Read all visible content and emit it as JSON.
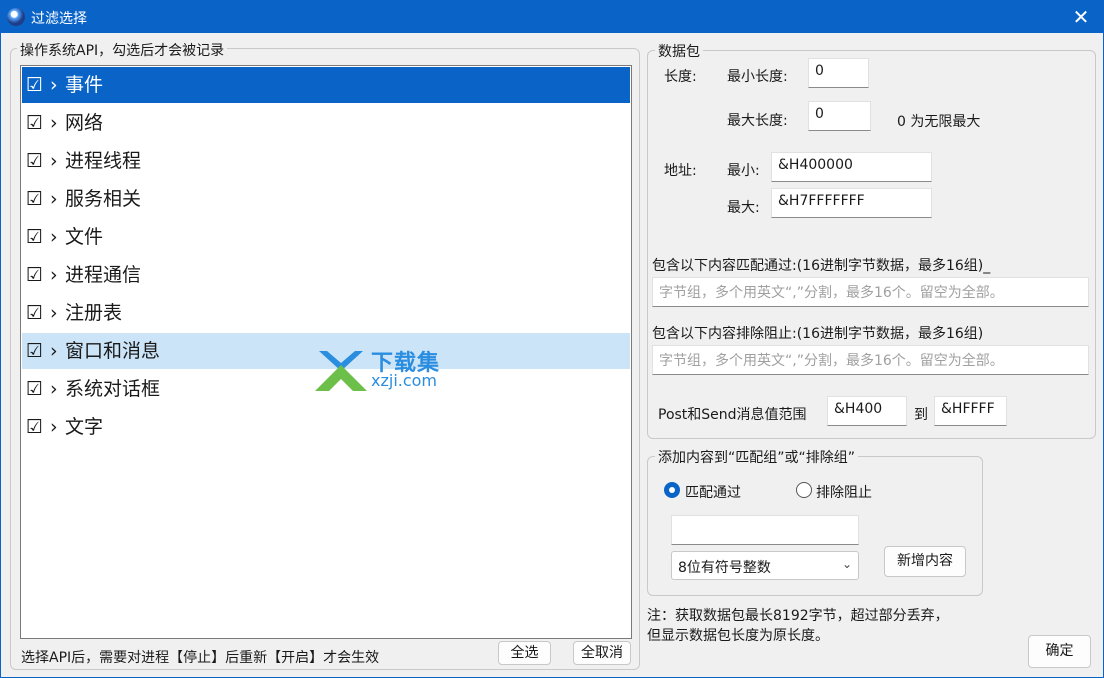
{
  "window": {
    "title": "过滤选择",
    "close_glyph": "✕"
  },
  "api_group": {
    "legend": "操作系统API，勾选后才会被记录",
    "items": [
      {
        "label": "事件"
      },
      {
        "label": "网络"
      },
      {
        "label": "进程线程"
      },
      {
        "label": "服务相关"
      },
      {
        "label": "文件"
      },
      {
        "label": "进程通信"
      },
      {
        "label": "注册表"
      },
      {
        "label": "窗口和消息"
      },
      {
        "label": "系统对话框"
      },
      {
        "label": "文字"
      }
    ],
    "check_glyph": "☑",
    "arrow_glyph": "›",
    "footer_note": "选择API后，需要对进程【停止】后重新【开启】才会生效",
    "select_all_label": "全选",
    "deselect_all_label": "全取消"
  },
  "packet_group": {
    "legend": "数据包",
    "length_label": "长度:",
    "min_length_label": "最小长度:",
    "min_length_value": "0",
    "max_length_label": "最大长度:",
    "max_length_value": "0",
    "unlimited_note": "0 为无限最大",
    "address_label": "地址:",
    "min_addr_label": "最小:",
    "min_addr_value": "&H400000",
    "max_addr_label": "最大:",
    "max_addr_value": "&H7FFFFFFF",
    "include_label": "包含以下内容匹配通过:(16进制字节数据，最多16组)_",
    "include_placeholder": "字节组，多个用英文“,”分割，最多16个。留空为全部。",
    "exclude_label": "包含以下内容排除阻止:(16进制字节数据，最多16组)",
    "exclude_placeholder": "字节组，多个用英文“,”分割，最多16个。留空为全部。",
    "msg_range_label": "Post和Send消息值范围",
    "msg_from": "&H400",
    "msg_to_label": "到",
    "msg_to": "&HFFFF"
  },
  "add_group": {
    "legend": "添加内容到“匹配组”或“排除组”",
    "radio_match_label": "匹配通过",
    "radio_exclude_label": "排除阻止",
    "value_input": "",
    "type_select": "8位有符号整数",
    "add_button_label": "新增内容"
  },
  "note": {
    "line1": "注：获取数据包最长8192字节，超过部分丢弃，",
    "line2": "但显示数据包长度为原长度。"
  },
  "ok_button_label": "确定",
  "watermark": {
    "line1": "下载集",
    "line2": "xzji.com"
  }
}
